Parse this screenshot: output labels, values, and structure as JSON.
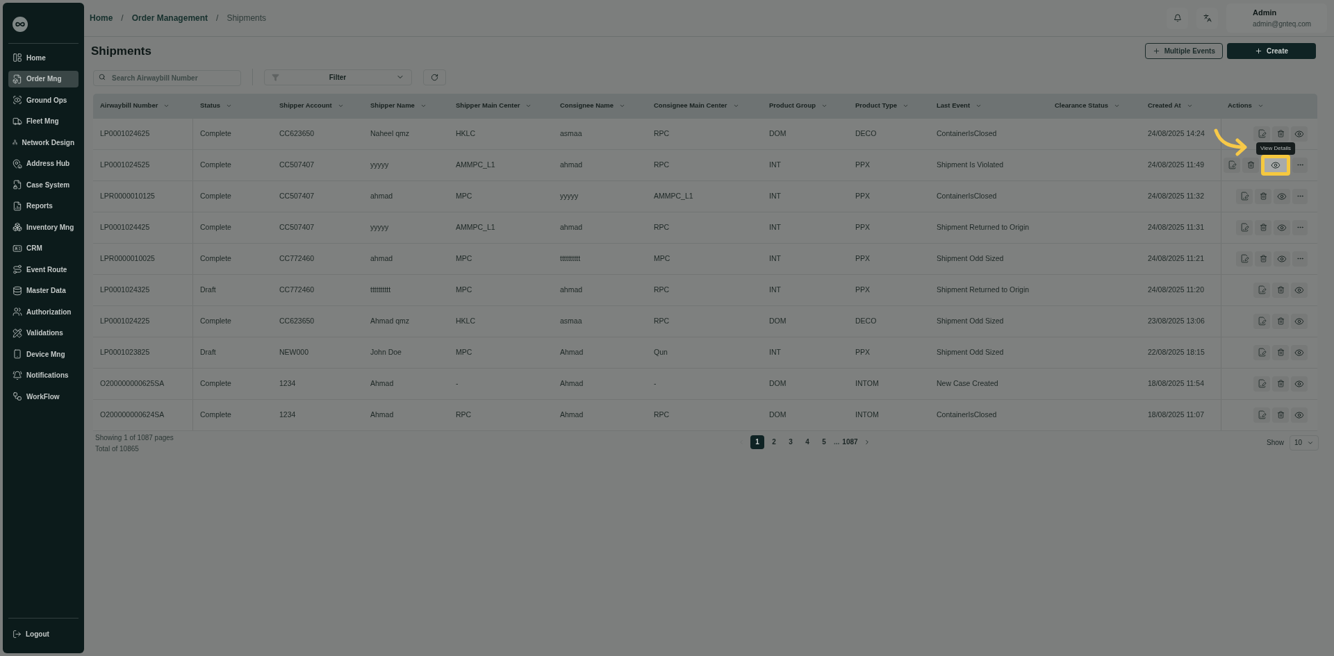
{
  "sidebar": {
    "items": [
      {
        "label": "Home",
        "selected": false
      },
      {
        "label": "Order Mng",
        "selected": true
      },
      {
        "label": "Ground Ops",
        "selected": false
      },
      {
        "label": "Fleet Mng",
        "selected": false
      },
      {
        "label": "Network Design",
        "selected": false
      },
      {
        "label": "Address Hub",
        "selected": false
      },
      {
        "label": "Case System",
        "selected": false
      },
      {
        "label": "Reports",
        "selected": false
      },
      {
        "label": "Inventory Mng",
        "selected": false
      },
      {
        "label": "CRM",
        "selected": false
      },
      {
        "label": "Event Route",
        "selected": false
      },
      {
        "label": "Master Data",
        "selected": false
      },
      {
        "label": "Authorization",
        "selected": false
      },
      {
        "label": "Validations",
        "selected": false
      },
      {
        "label": "Device Mng",
        "selected": false
      },
      {
        "label": "Notifications",
        "selected": false
      },
      {
        "label": "WorkFlow",
        "selected": false
      }
    ],
    "logout": "Logout"
  },
  "breadcrumbs": {
    "items": [
      "Home",
      "Order Management",
      "Shipments"
    ],
    "separator": "/"
  },
  "user": {
    "name": "Admin",
    "email": "admin@gnteq.com"
  },
  "page_title": "Shipments",
  "buttons": {
    "multiple_events": "Multiple Events",
    "create": "Create"
  },
  "search": {
    "placeholder": "Search Airwaybill Number"
  },
  "filter": {
    "label": "Filter"
  },
  "table": {
    "columns": [
      "Airwaybill Number",
      "Status",
      "Shipper Account",
      "Shipper Name",
      "Shipper Main Center",
      "Consignee Name",
      "Consignee Main Center",
      "Product Group",
      "Product Type",
      "Last Event",
      "Clearance Status",
      "Created At",
      "Actions"
    ],
    "rows": [
      {
        "cells": [
          "LP0001024625",
          "Complete",
          "CC623650",
          "Naheel qmz",
          "HKLC",
          "asmaa",
          "RPC",
          "DOM",
          "DECO",
          "ContainerIsClosed",
          "",
          "24/08/2025 14:24"
        ],
        "more": false,
        "highlighted": false
      },
      {
        "cells": [
          "LP0001024525",
          "Complete",
          "CC507407",
          "yyyyy",
          "AMMPC_L1",
          "ahmad",
          "RPC",
          "INT",
          "PPX",
          "Shipment Is Violated",
          "",
          "24/08/2025 11:49"
        ],
        "more": true,
        "highlighted": true,
        "tooltip": "View Details"
      },
      {
        "cells": [
          "LPR0000010125",
          "Complete",
          "CC507407",
          "ahmad",
          "MPC",
          "yyyyy",
          "AMMPC_L1",
          "INT",
          "PPX",
          "ContainerIsClosed",
          "",
          "24/08/2025 11:32"
        ],
        "more": true,
        "highlighted": false
      },
      {
        "cells": [
          "LP0001024425",
          "Complete",
          "CC507407",
          "yyyyy",
          "AMMPC_L1",
          "ahmad",
          "RPC",
          "INT",
          "PPX",
          "Shipment Returned to Origin",
          "",
          "24/08/2025 11:31"
        ],
        "more": true,
        "highlighted": false
      },
      {
        "cells": [
          "LPR0000010025",
          "Complete",
          "CC772460",
          "ahmad",
          "MPC",
          "tttttttttt",
          "MPC",
          "INT",
          "PPX",
          "Shipment Odd Sized",
          "",
          "24/08/2025 11:21"
        ],
        "more": true,
        "highlighted": false
      },
      {
        "cells": [
          "LP0001024325",
          "Draft",
          "CC772460",
          "tttttttttt",
          "MPC",
          "ahmad",
          "RPC",
          "INT",
          "PPX",
          "Shipment Returned to Origin",
          "",
          "24/08/2025 11:20"
        ],
        "more": false,
        "highlighted": false
      },
      {
        "cells": [
          "LP0001024225",
          "Complete",
          "CC623650",
          "Ahmad qmz",
          "HKLC",
          "asmaa",
          "RPC",
          "DOM",
          "DECO",
          "Shipment Odd Sized",
          "",
          "23/08/2025 13:06"
        ],
        "more": false,
        "highlighted": false
      },
      {
        "cells": [
          "LP0001023825",
          "Draft",
          "NEW000",
          "John Doe",
          "MPC",
          "Ahmad",
          "Qun",
          "INT",
          "PPX",
          "Shipment Odd Sized",
          "",
          "22/08/2025 18:15"
        ],
        "more": false,
        "highlighted": false
      },
      {
        "cells": [
          "O200000000625SA",
          "Complete",
          "1234",
          "Ahmad",
          "-",
          "Ahmad",
          "-",
          "DOM",
          "INTOM",
          "New Case Created",
          "",
          "18/08/2025 11:54"
        ],
        "more": false,
        "highlighted": false
      },
      {
        "cells": [
          "O200000000624SA",
          "Complete",
          "1234",
          "Ahmad",
          "RPC",
          "Ahmad",
          "RPC",
          "DOM",
          "INTOM",
          "ContainerIsClosed",
          "",
          "18/08/2025 11:07"
        ],
        "more": false,
        "highlighted": false
      }
    ]
  },
  "summary": {
    "pages": "Showing 1 of 1087 pages",
    "total": "Total of 10865"
  },
  "pagination": {
    "prev_disabled": true,
    "pages": [
      {
        "label": "1",
        "selected": true
      },
      {
        "label": "2",
        "selected": false
      },
      {
        "label": "3",
        "selected": false
      },
      {
        "label": "4",
        "selected": false
      },
      {
        "label": "5",
        "selected": false
      }
    ],
    "ellipsis": "...",
    "last": "1087"
  },
  "page_size": {
    "label": "Show",
    "value": "10"
  }
}
